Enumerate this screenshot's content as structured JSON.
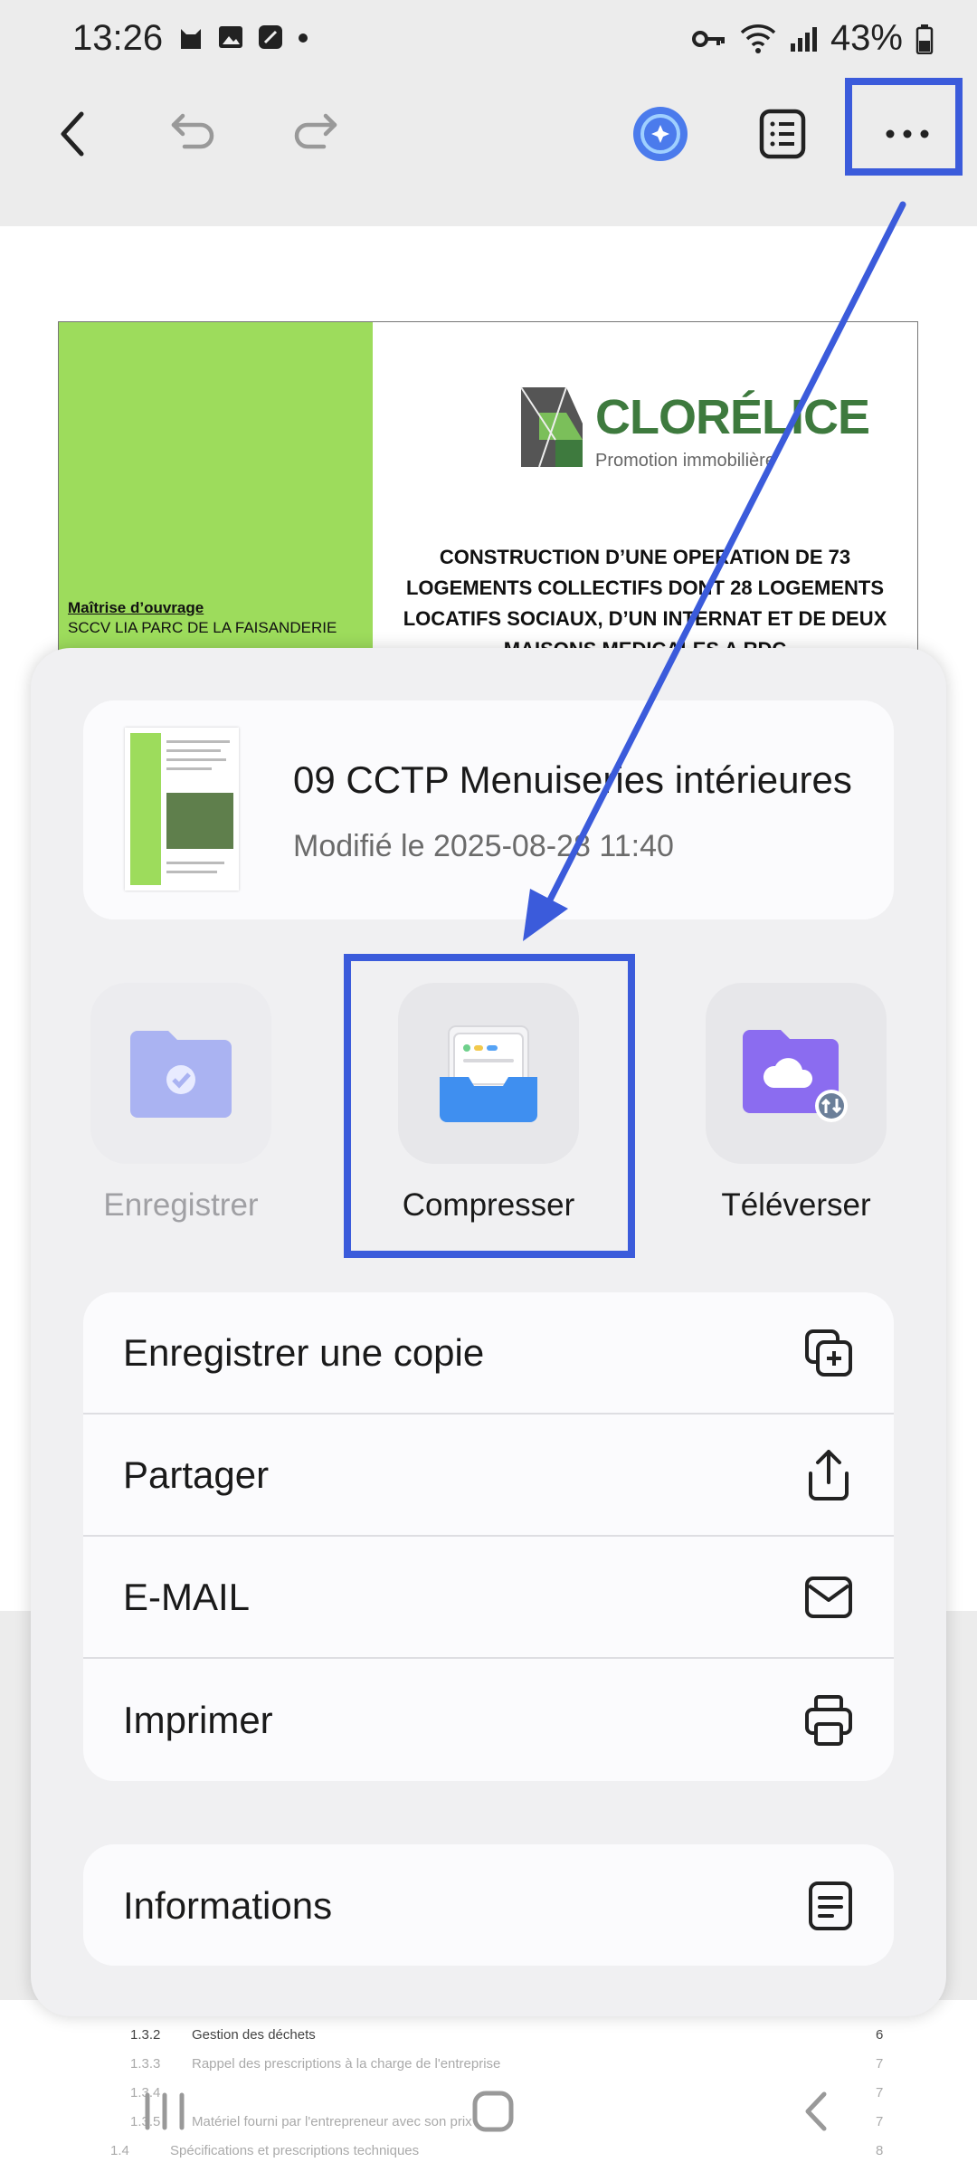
{
  "status_bar": {
    "time": "13:26",
    "battery": "43%"
  },
  "document": {
    "brand_name": "CLORÉLICE",
    "brand_tagline": "Promotion immobilière",
    "title_lines": [
      "CONSTRUCTION D’UNE OPERATION DE 73",
      "LOGEMENTS COLLECTIFS DONT 28 LOGEMENTS",
      "LOCATIFS SOCIAUX, D’UN INTERNAT ET DE DEUX",
      "MAISONS MEDICALES A RDC"
    ],
    "owner_heading": "Maîtrise d’ouvrage",
    "owner_name": "SCCV LIA PARC DE LA FAISANDERIE",
    "toc": [
      {
        "num": "1.3.2",
        "text": "Gestion des déchets",
        "page": "6"
      },
      {
        "num": "1.3.3",
        "text": "Rappel des prescriptions à la charge de l'entreprise",
        "page": "7"
      },
      {
        "num": "1.3.4",
        "text": "",
        "page": "7"
      },
      {
        "num": "1.3.5",
        "text": "Matériel fourni par l'entrepreneur avec son prix",
        "page": "7"
      },
      {
        "num": "1.4",
        "text": "Spécifications et prescriptions techniques",
        "page": "8"
      }
    ]
  },
  "sheet": {
    "file_name": "09 CCTP Menuiseries intérieures",
    "file_date": "Modifié le 2025-08-28 11:40",
    "actions": [
      {
        "label": "Enregistrer",
        "icon": "folder-check-icon",
        "enabled": false
      },
      {
        "label": "Compresser",
        "icon": "archive-box-icon",
        "enabled": true
      },
      {
        "label": "Téléverser",
        "icon": "cloud-folder-upload-icon",
        "enabled": true
      }
    ],
    "menu": [
      {
        "label": "Enregistrer une copie",
        "icon": "copy-plus-icon"
      },
      {
        "label": "Partager",
        "icon": "share-icon"
      },
      {
        "label": "E-MAIL",
        "icon": "mail-icon"
      },
      {
        "label": "Imprimer",
        "icon": "printer-icon"
      }
    ],
    "info": {
      "label": "Informations",
      "icon": "document-info-icon"
    }
  },
  "colors": {
    "accent": "#3b5bdb",
    "doc_green": "#9ddc5c",
    "brand_green": "#3e7a3e"
  }
}
